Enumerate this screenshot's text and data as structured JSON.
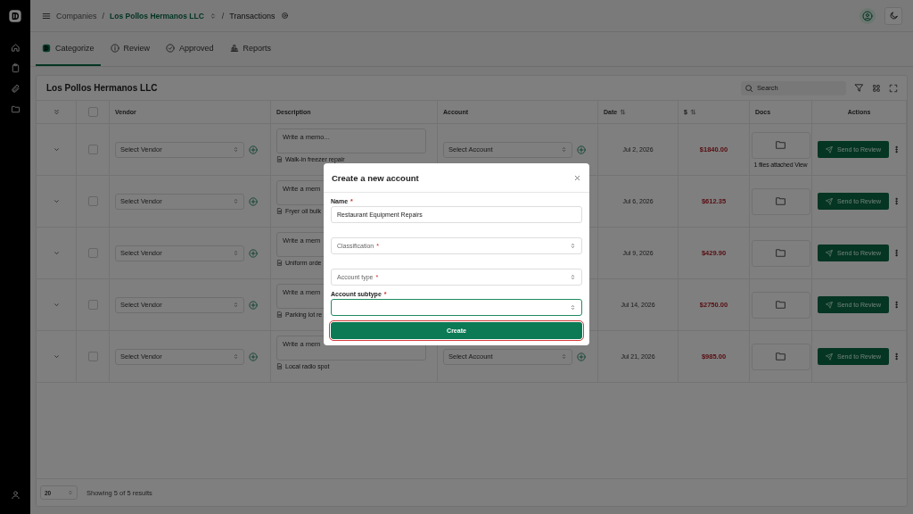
{
  "breadcrumb": [
    {
      "kind": "link",
      "label": "Companies"
    },
    {
      "kind": "separator",
      "label": "/"
    },
    {
      "kind": "company",
      "label": "Los Pollos Hermanos LLC"
    },
    {
      "kind": "separator",
      "label": "/"
    },
    {
      "kind": "current",
      "label": "Transactions"
    }
  ],
  "tabs": [
    {
      "label": "Categorize",
      "selected": true
    },
    {
      "label": "Review",
      "selected": false
    },
    {
      "label": "Approved",
      "selected": false
    },
    {
      "label": "Reports",
      "selected": false
    }
  ],
  "card": {
    "title": "Los Pollos Hermanos LLC",
    "search": {
      "placeholder": "Search"
    }
  },
  "table": {
    "header_checked": false,
    "columns": [
      {
        "kind": "expand"
      },
      {
        "kind": "checkbox"
      },
      {
        "kind": "text",
        "label": "Vendor"
      },
      {
        "kind": "text",
        "label": "Description"
      },
      {
        "kind": "text",
        "label": "Account"
      },
      {
        "kind": "sortable",
        "label": "Date"
      },
      {
        "kind": "sortable",
        "label": "$"
      },
      {
        "kind": "text",
        "label": "Docs"
      },
      {
        "kind": "actions",
        "label": "Actions"
      }
    ],
    "rows": [
      {
        "checked": false,
        "vendor_placeholder": "Select Vendor",
        "memo_placeholder": "Write a memo...",
        "description": "Walk-in freezer repair",
        "account_placeholder": "Select Account",
        "date": "Jul 2, 2026",
        "amount": "$1840.00",
        "attachment_note": "1 files attached View",
        "action": "Send to Review"
      },
      {
        "checked": false,
        "vendor_placeholder": "Select Vendor",
        "memo_placeholder": "Write a mem",
        "description": "Fryer oil bulk",
        "date": "Jul 6, 2026",
        "amount": "$612.35",
        "action": "Send to Review"
      },
      {
        "checked": false,
        "vendor_placeholder": "Select Vendor",
        "memo_placeholder": "Write a mem",
        "description": "Uniform orde",
        "date": "Jul 9, 2026",
        "amount": "$429.90",
        "action": "Send to Review"
      },
      {
        "checked": false,
        "vendor_placeholder": "Select Vendor",
        "memo_placeholder": "Write a mem",
        "description": "Parking lot re",
        "date": "Jul 14, 2026",
        "amount": "$2750.00",
        "action": "Send to Review"
      },
      {
        "checked": false,
        "vendor_placeholder": "Select Vendor",
        "memo_placeholder": "Write a mem",
        "description": "Local radio spot",
        "account_placeholder": "Select Account",
        "date": "Jul 21, 2026",
        "amount": "$985.00",
        "action": "Send to Review"
      }
    ]
  },
  "footer": {
    "page_size": "20",
    "summary": "Showing 5 of 5 results"
  },
  "modal": {
    "title": "Create a new account",
    "fields": [
      {
        "kind": "text",
        "label": "Name",
        "required_mark": "*",
        "value": "Restaurant Equipment Repairs",
        "focused": false
      },
      {
        "kind": "select",
        "placeholder": "Classification",
        "required_mark": "*",
        "focused": false
      },
      {
        "kind": "select",
        "placeholder": "Account type",
        "required_mark": "*",
        "focused": false
      },
      {
        "kind": "select",
        "label": "Account subtype",
        "required_mark": "*",
        "focused": true
      }
    ],
    "submit": "Create"
  }
}
